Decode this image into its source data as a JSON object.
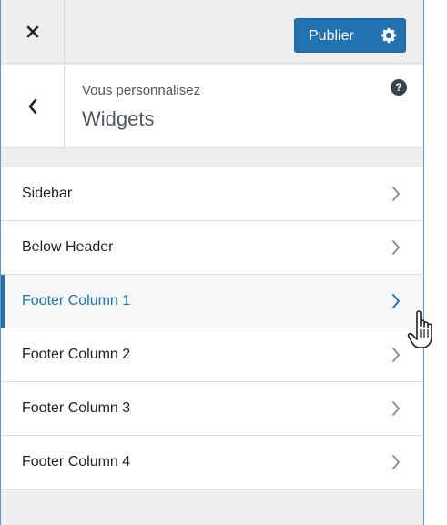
{
  "toolbar": {
    "close_icon": "close-icon",
    "publish_label": "Publier",
    "settings_icon": "gear-icon",
    "accent": "#2271b1"
  },
  "header": {
    "back_icon": "chevron-left-icon",
    "subtitle": "Vous personnalisez",
    "title": "Widgets",
    "help_icon": "help-icon",
    "help_glyph": "?"
  },
  "widget_areas": [
    {
      "label": "Sidebar",
      "active": false
    },
    {
      "label": "Below Header",
      "active": false
    },
    {
      "label": "Footer Column 1",
      "active": true
    },
    {
      "label": "Footer Column 2",
      "active": false
    },
    {
      "label": "Footer Column 3",
      "active": false
    },
    {
      "label": "Footer Column 4",
      "active": false
    }
  ]
}
